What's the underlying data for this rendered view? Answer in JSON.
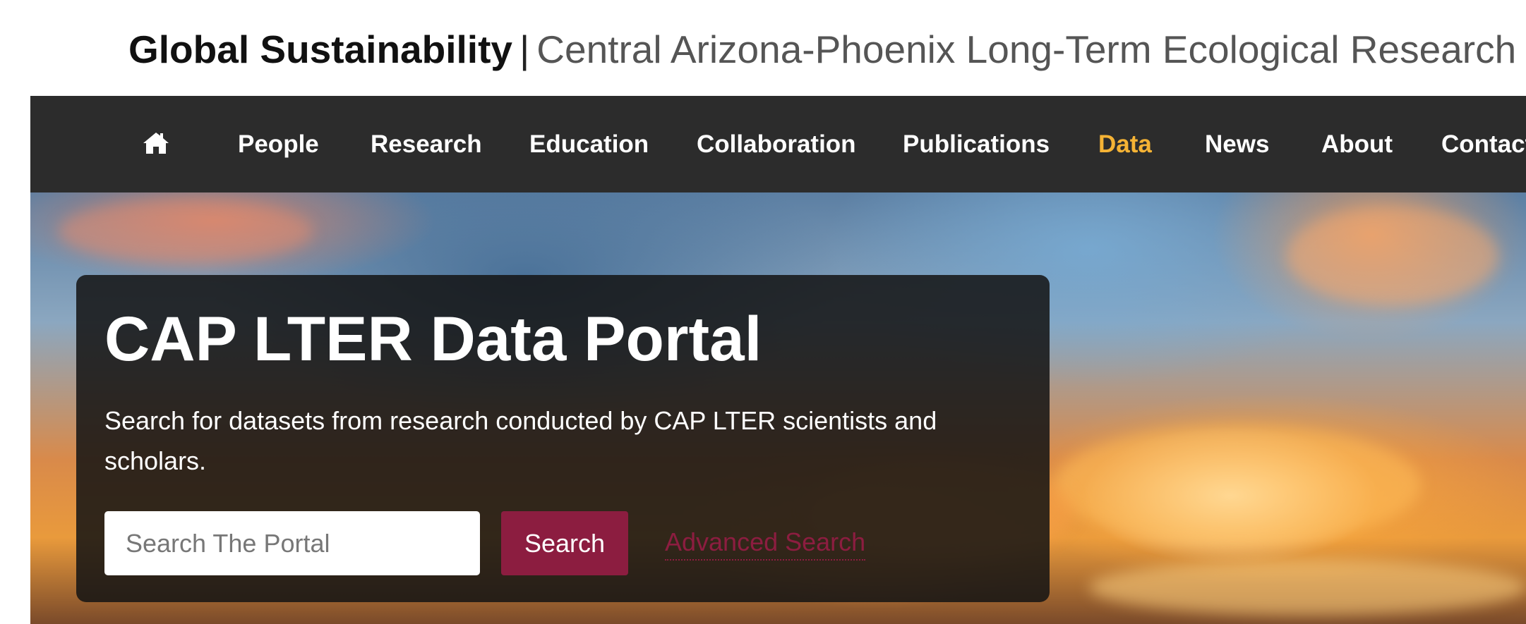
{
  "header": {
    "org_name": "Global Sustainability",
    "separator": "|",
    "site_name": "Central Arizona-Phoenix Long-Term Ecological Research"
  },
  "nav": {
    "home_icon": "home-icon",
    "items": [
      {
        "label": "People"
      },
      {
        "label": "Research"
      },
      {
        "label": "Education"
      },
      {
        "label": "Collaboration"
      },
      {
        "label": "Publications"
      },
      {
        "label": "Data",
        "active": true
      },
      {
        "label": "News"
      },
      {
        "label": "About"
      },
      {
        "label": "Contact"
      }
    ]
  },
  "portal": {
    "title": "CAP LTER Data Portal",
    "description": "Search for datasets from research conducted by CAP LTER scientists and scholars.",
    "search_placeholder": "Search The Portal",
    "search_value": "",
    "search_button": "Search",
    "advanced_link": "Advanced Search"
  },
  "colors": {
    "nav_bg": "#2c2c2c",
    "nav_active": "#f5b335",
    "accent_maroon": "#8c1d40"
  }
}
